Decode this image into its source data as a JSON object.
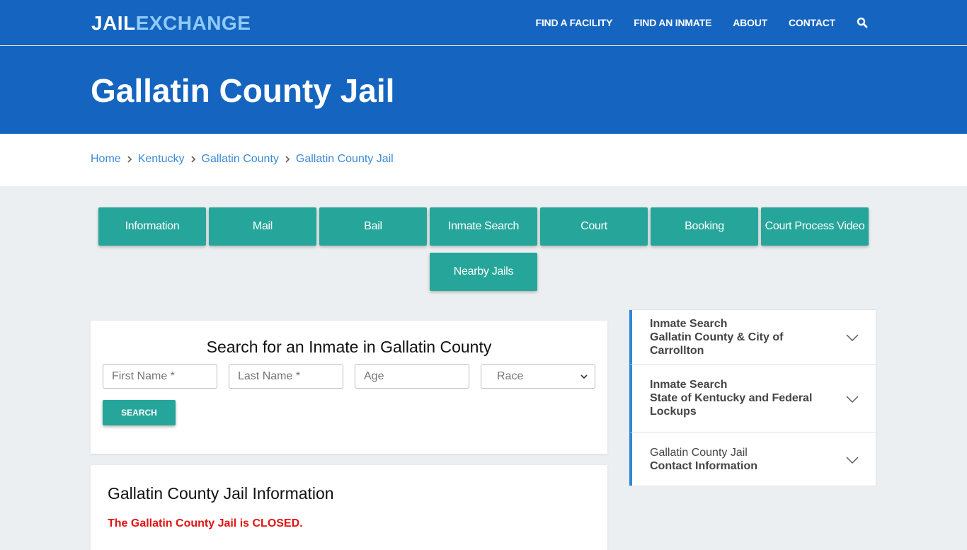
{
  "header": {
    "logo_part1": "JAIL",
    "logo_part2": "EXCHANGE",
    "nav": [
      "FIND A FACILITY",
      "FIND AN INMATE",
      "ABOUT",
      "CONTACT"
    ],
    "search_icon": "search-icon"
  },
  "hero": {
    "title": "Gallatin County Jail"
  },
  "breadcrumb": [
    "Home",
    "Kentucky",
    "Gallatin County",
    "Gallatin County Jail"
  ],
  "tabs": {
    "row1": [
      "Information",
      "Mail",
      "Bail",
      "Inmate Search",
      "Court",
      "Booking",
      "Court Process Video"
    ],
    "row2": [
      "Nearby Jails"
    ]
  },
  "search": {
    "title": "Search for an Inmate in Gallatin County",
    "first_name_placeholder": "First Name *",
    "last_name_placeholder": "Last Name *",
    "age_placeholder": "Age",
    "race_selected": "Race",
    "button": "SEARCH"
  },
  "info": {
    "title": "Gallatin County Jail Information",
    "status": "The Gallatin County Jail is CLOSED."
  },
  "accordion": [
    {
      "line1": "Inmate Search",
      "line2": "Gallatin County & City of Carrollton"
    },
    {
      "line1": "Inmate Search",
      "line2": "State of Kentucky and Federal Lockups"
    },
    {
      "line1": "Gallatin County Jail",
      "line2": "Contact Information"
    }
  ],
  "colors": {
    "brand_blue": "#1565c0",
    "logo_accent": "#90caf9",
    "teal_button": "#26a69a",
    "link_blue": "#3b8ad8",
    "alert_red": "#e01515",
    "accordion_accent": "#2e88d6"
  }
}
